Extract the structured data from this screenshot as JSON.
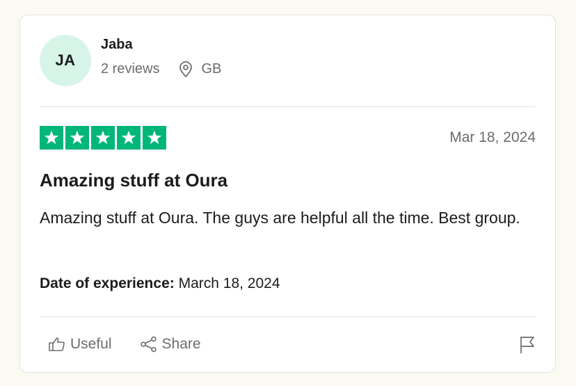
{
  "reviewer": {
    "initials": "JA",
    "name": "Jaba",
    "reviews_count": "2 reviews",
    "location": "GB",
    "avatar_color": "#d6f5e8"
  },
  "review": {
    "rating": 5,
    "max_rating": 5,
    "star_color": "#00b67a",
    "date": "Mar 18, 2024",
    "title": "Amazing stuff at Oura",
    "body": "Amazing stuff at Oura. The guys are helpful all the time. Best group.",
    "experience_label": "Date of experience:",
    "experience_date": "March 18, 2024"
  },
  "actions": {
    "useful_label": "Useful",
    "share_label": "Share",
    "useful_icon": "thumbs-up-icon",
    "share_icon": "share-icon",
    "flag_icon": "flag-icon"
  }
}
